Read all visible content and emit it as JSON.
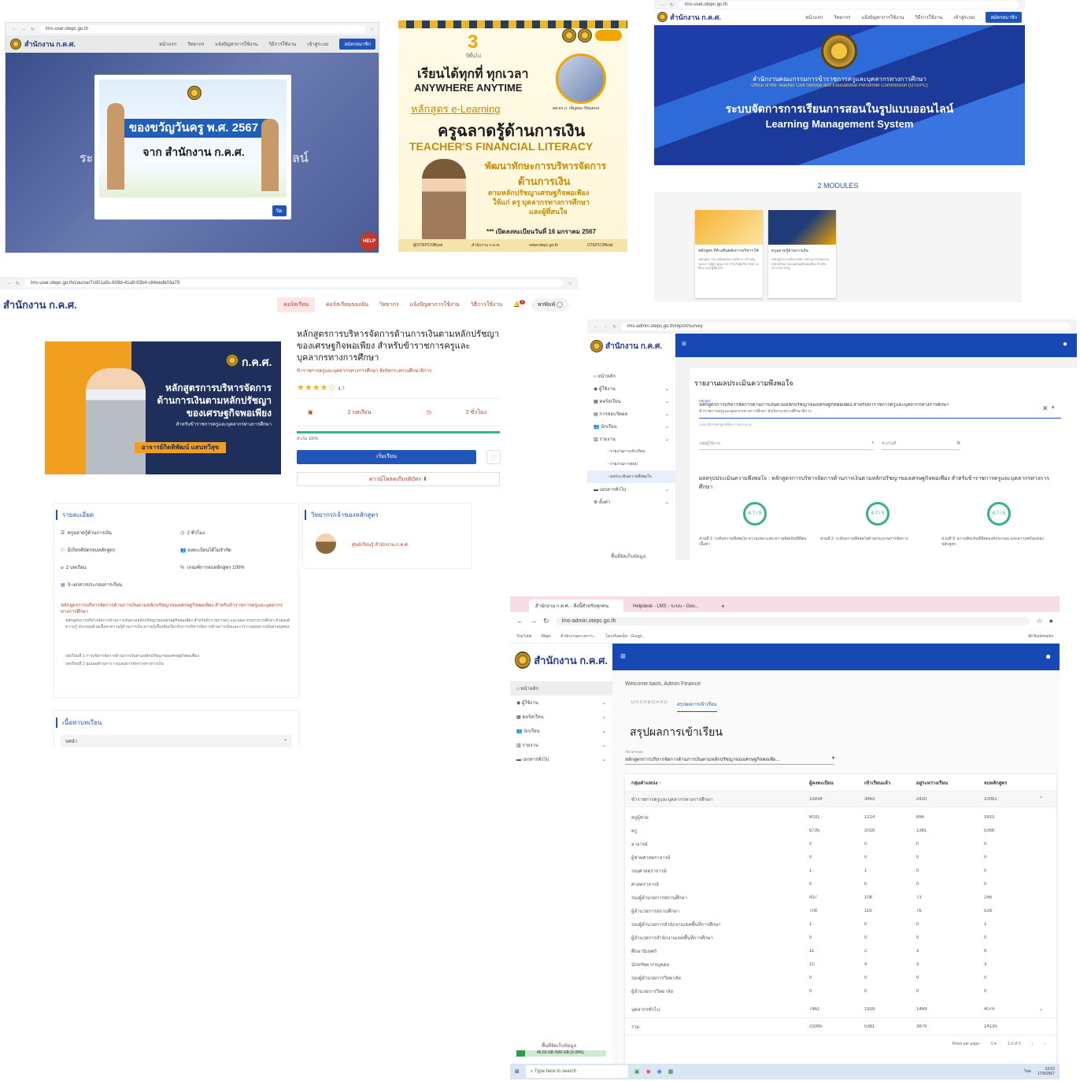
{
  "s1": {
    "url": "lms-user.otepc.go.th",
    "logo": "สำนักงาน ก.ค.ศ.",
    "nav": [
      "หน้าแรก",
      "วิทยากร",
      "แจ้งปัญหาการใช้งาน",
      "วิธีการใช้งาน",
      "เข้าสู่ระบบ"
    ],
    "register": "สมัครสมาชิก",
    "popup_line1": "ของขวัญวันครู พ.ศ. 2567",
    "popup_line2": "จาก สำนักงาน ก.ค.ศ.",
    "popup_btn": "ปิด",
    "bg_text_left": "ระ",
    "bg_text_right": "ลน์",
    "help": "HELP"
  },
  "s2": {
    "big3": "3",
    "big3_sub": "ปีขึ้นไป",
    "tagline_th": "เรียนได้ทุกที่ ทุกเวลา",
    "tagline_en": "ANYWHERE ANYTIME",
    "elearning": "หลักสูตร e-Learning",
    "title_th": "ครูฉลาดรู้ด้านการเงิน",
    "title_en": "TEACHER'S FINANCIAL LITERACY",
    "sub1": "พัฒนาทักษะการบริหารจัดการ",
    "sub2": "ด้านการเงิน",
    "sub3": "ตามหลักปรัชญาเศรษฐกิจพอเพียง",
    "sub4": "ให้แก่ ครู บุคลากรทางการศึกษา",
    "sub5": "และผู้ที่สนใจ",
    "open_date": "*** เปิดลงทะเบียนวันที่ 16 มกราคม 2567",
    "person_caption": "ผศ.ดร.ภ. เพ็ญผ่อง ปัทมธมน",
    "footer": [
      "@OTEPCOfficial",
      "สำนักงาน ก.ค.ศ.",
      "www.otepc.go.th",
      "OTEPCOfficial"
    ]
  },
  "s3": {
    "url": "lms-user.otepc.go.th",
    "logo": "สำนักงาน ก.ค.ศ.",
    "nav": [
      "หน้าแรก",
      "วิทยากร",
      "แจ้งปัญหาการใช้งาน",
      "วิธีการใช้งาน",
      "เข้าสู่ระบบ"
    ],
    "register": "สมัครสมาชิก",
    "org_th": "สำนักงานคณะกรรมการข้าราชการครูและบุคลากรทางการศึกษา",
    "org_en": "Office of the Teacher Civil Service and Educational Personnel Commission (OTEPC)",
    "title_th": "ระบบจัดการการเรียนการสอนในรูปแบบออนไลน์",
    "title_en": "Learning Management System",
    "modules": "2 MODULES",
    "cards": [
      {
        "title": "หลักสูตร PA เสริมพลังการบริหาร 54",
        "desc": "หลักสูตร \"PA เสริมพลังการบริหาร สร้างครูของเรา สู่ผู้นำคุณภาพ\" สำหรับผู้บริหารสถานศึกษาและผู้ที่สนใจ"
      },
      {
        "title": "ครูฉลาดรู้ด้านการเงิน",
        "desc": "หลักสูตรการบริหารจัดการด้านการเงินตามหลักปรัชญาของเศรษฐกิจพอเพียง สำหรับข้าราชการครู"
      }
    ]
  },
  "s4": {
    "url": "lms-user.otepc.go.th/course/7c801a5c-609d-41a9-93b4-c84eedb03a79",
    "logo": "สำนักงาน ก.ค.ศ.",
    "nav": [
      "คอร์สเรียน",
      "คอร์สเรียนของฉัน",
      "วิทยากร",
      "แจ้งปัญหาการใช้งาน",
      "วิธีการใช้งาน"
    ],
    "notif": "2",
    "user": "พรพิมพ์",
    "banner_brand": "ก.ค.ศ.",
    "banner_line1": "หลักสูตรการบริหารจัดการ",
    "banner_line2": "ด้านการเงินตามหลักปรัชญา",
    "banner_line3": "ของเศรษฐกิจพอเพียง",
    "banner_line4": "สำหรับข้าราชการครูและบุคลากรทางการศึกษา",
    "banner_name": "อาจารย์กิตติพัฒน์  แสนทวีสุข",
    "course_title": "หลักสูตรการบริหารจัดการด้านการเงินตามหลักปรัชญาของเศรษฐกิจพอเพียง สำหรับข้าราชการครูและบุคลากรทางการศึกษา",
    "course_sub": "ข้าราชการครูและบุคลากรทางการศึกษา สังกัดกระทรวงศึกษาธิการ",
    "rating": "4.7",
    "units": "2 บทเรียน",
    "hours": "2 ชั่วโมง",
    "progress_label": "สำเร็จ 100%",
    "progress": 100,
    "start_btn": "เริ่มเรียน",
    "cert_btn": "ดาวน์โหลดเกียรติบัตร",
    "detail_head": "รายละเอียด",
    "details": [
      "ครูฉลาดรู้ด้านการเงิน",
      "2 ชั่วโมง",
      "มีเกียรติบัตรจบหลักสูตร",
      "ลงทะเบียนได้ไม่จำกัด",
      "2 บทเรียน",
      "เกณฑ์การจบหลักสูตร 100%",
      "9 เอกสารประกอบการเรียน"
    ],
    "instructor_head": "วิทยากร/เจ้าของหลักสูตร",
    "instructor": "ศูนย์เรียนรู้ สำนักงาน ก.ค.ศ.",
    "desc_title": "หลักสูตรการบริหารจัดการด้านการเงินตามหลักปรัชญาของเศรษฐกิจพอเพียง สำหรับข้าราชการครูและบุคลากรทางการศึกษา",
    "desc_body": "หลักสูตรการบริหารจัดการด้านการเงินตามหลักปรัชญาของเศรษฐกิจพอเพียง สำหรับข้าราชการครู และบุคลากรทางการศึกษา ด้วยองค์ความรู้ ประกอบด้วยเนื้อหาความรู้ด้านการเงิน ความรู้เบื้องต้นเกี่ยวกับการบริหารจัดการด้านการเงินและการวางแผนการเงินส่วนบุคคล",
    "lesson1": "บทเรียนที่ 1 การบริหารจัดการด้านการเงินตามหลักปรัชญาของเศรษฐกิจพอเพียง",
    "lesson2": "บทเรียนที่ 2 มุมมองด้านการวางแผนการจัดการทางการเงิน",
    "content_head": "เนื้อหาบทเรียน",
    "content_row": "บทนำ"
  },
  "s5": {
    "url": "lms-admin.otepc.go.th/report/survey",
    "logo": "สำนักงาน ก.ค.ศ.",
    "sidebar": [
      "หน้าหลัก",
      "ผู้ใช้งาน",
      "คอร์สเรียน",
      "การสอบวัดผล",
      "นักเรียน",
      "รายงาน",
      "- รายงานการเข้าเรียน",
      "- รายงานการสอบ",
      "- ผลประเมินความพึงพอใจ",
      "เอกสารทั่วไป",
      "ตั้งค่า"
    ],
    "storage": "พื้นที่จัดเก็บข้อมูล",
    "title": "รายงานผลประเมินความพึงพอใจ",
    "course_label": "หลักสูตร",
    "course_value": "หลักสูตรการบริหารจัดการด้านการเงินตามหลักปรัชญาของเศรษฐกิจพอเพียง สำหรับข้าราชการครูและบุคลากรทางการศึกษา",
    "course_value2": "ข้าราชการครูและบุคลากรทางการศึกษา สังกัดกระทรวงศึกษาธิการ",
    "hint": "กรุณาเลือกหลักสูตรที่ต้องการดูรายงาน",
    "group_label": "กลุ่มผู้ใช้งาน",
    "date_label": "ช่วงวันที่",
    "summary": "ผลสรุปประเมินความพึงพอใจ : หลักสูตรการบริหารจัดการด้านการเงินตามหลักปรัชญาของเศรษฐกิจพอเพียง สำหรับข้าราชการครูและบุคลากรทางการศึกษา",
    "scores": [
      "4.7 / 5",
      "4.7 / 5",
      "4.7 / 5"
    ],
    "parts": [
      "ส่วนที่ 1: ระดับความพึงพอใจ ความเหมาะสม ความคิดเห็นที่มีต่อเนื้อหา",
      "ส่วนที่ 2: ระดับความพึงพอใจด้านกระบวนการจัดการ",
      "ส่วนที่ 3: ความคิดเห็นที่มีต่อองค์ประกอบ และความพร้อมของหลักสูตร"
    ]
  },
  "s6": {
    "tabs": [
      "สำนักงาน ก.ค.ศ. - สิ่งนี้สำหรับทุกคน",
      "Helpdesk - LMS - ระบบ - Goo..."
    ],
    "url": "lms-admin.otepc.go.th",
    "bookmarks": [
      "YouTube",
      "Maps",
      "สำนักงานตรวจการ...",
      "โครงร้อยเอ็ด - Googl...",
      "All Bookmarks"
    ],
    "logo": "สำนักงาน ก.ค.ศ.",
    "sidebar": [
      "หน้าหลัก",
      "ผู้ใช้งาน",
      "คอร์สเรียน",
      "นักเรียน",
      "รายงาน",
      "เอกสารทั่วไป"
    ],
    "welcome": "Welcome back, Admin Finance",
    "subtabs": [
      "DASHBOARD",
      "สรุปผลการเข้าเรียน"
    ],
    "title": "สรุปผลการเข้าเรียน",
    "course_label": "เลือกหลักสูตร",
    "course_value": "หลักสูตรการบริหารจัดการด้านการเงินตามหลักปรัชญาของเศรษฐกิจพอเพีย...",
    "columns": [
      "กลุ่มตำแหน่ง ↑",
      "ผู้ลงทะเบียน",
      "เข้าเรียนแล้ว",
      "อยู่ระหว่างเรียน",
      "จบหลักสูตร"
    ],
    "group_row": {
      "name": "ข้าราชการครูและบุคลากรทางการศึกษา",
      "v": [
        "15934",
        "3463",
        "2410",
        "10061"
      ]
    },
    "rows": [
      {
        "name": "ครูผู้ช่วย",
        "v": [
          "6031",
          "1214",
          "894",
          "3923"
        ]
      },
      {
        "name": "ครู",
        "v": [
          "8735",
          "2018",
          "1361",
          "5356"
        ]
      },
      {
        "name": "อาจารย์",
        "v": [
          "0",
          "0",
          "0",
          "0"
        ]
      },
      {
        "name": "ผู้ช่วยศาสตราจารย์",
        "v": [
          "0",
          "0",
          "0",
          "0"
        ]
      },
      {
        "name": "รองศาสตราจารย์",
        "v": [
          "1",
          "1",
          "0",
          "0"
        ]
      },
      {
        "name": "ศาสตราจารย์",
        "v": [
          "0",
          "0",
          "0",
          "0"
        ]
      },
      {
        "name": "รองผู้อำนวยการสถานศึกษา",
        "v": [
          "437",
          "108",
          "73",
          "256"
        ]
      },
      {
        "name": "ผู้อำนวยการสถานศึกษา",
        "v": [
          "708",
          "116",
          "76",
          "516"
        ]
      },
      {
        "name": "รองผู้อำนวยการสำนักงานเขตพื้นที่การศึกษา",
        "v": [
          "1",
          "0",
          "0",
          "1"
        ]
      },
      {
        "name": "ผู้อำนวยการสำนักงานเขตพื้นที่การศึกษา",
        "v": [
          "0",
          "0",
          "0",
          "0"
        ]
      },
      {
        "name": "ศึกษานิเทศก์",
        "v": [
          "11",
          "2",
          "3",
          "6"
        ]
      },
      {
        "name": "นักทรัพยากรบุคคล",
        "v": [
          "10",
          "4",
          "3",
          "3"
        ]
      },
      {
        "name": "รองผู้อำนวยการวิทยาลัย",
        "v": [
          "0",
          "0",
          "0",
          "0"
        ]
      },
      {
        "name": "ผู้อำนวยการวิทยาลัย",
        "v": [
          "0",
          "0",
          "0",
          "0"
        ]
      }
    ],
    "other_row": {
      "name": "บุคลากรทั่วไป",
      "v": [
        "7461",
        "1918",
        "1469",
        "4074"
      ]
    },
    "total_row": {
      "name": "รวม",
      "v": [
        "23395",
        "5381",
        "3879",
        "14135"
      ]
    },
    "rows_per_page": "Rows per page:",
    "rpp_value": "5",
    "range": "1-3 of 3",
    "storage": "พื้นที่จัดเก็บข้อมูล",
    "storage_val": "46.93 GB /500 GB  (9.39%)",
    "storage_pct": 9.39,
    "search": "Type here to search",
    "time": "13:02",
    "date": "17/9/2567",
    "lang": "ไทย"
  }
}
